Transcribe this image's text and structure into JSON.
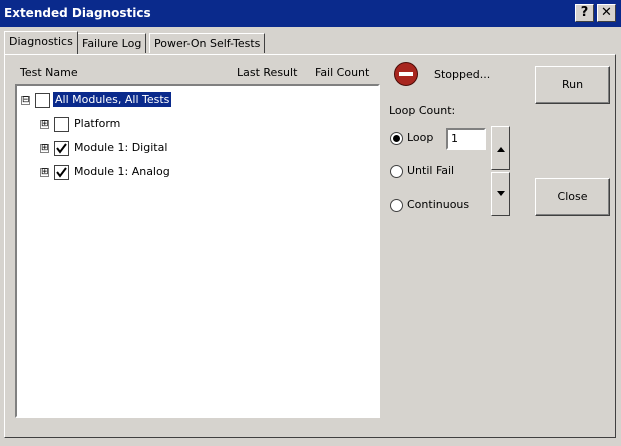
{
  "window": {
    "title": "Extended Diagnostics",
    "help_label": "?",
    "close_label": "✕"
  },
  "tabs": [
    {
      "label": "Diagnostics",
      "active": true
    },
    {
      "label": "Failure Log",
      "active": false
    },
    {
      "label": "Power-On Self-Tests",
      "active": false
    }
  ],
  "tree": {
    "headers": {
      "name": "Test Name",
      "last_result": "Last Result",
      "fail_count": "Fail Count"
    },
    "items": [
      {
        "label": "All Modules, All Tests",
        "checked": false,
        "expander": "⊟",
        "selected": true
      },
      {
        "label": "Platform",
        "checked": false,
        "expander": "⊞"
      },
      {
        "label": "Module 1: Digital",
        "checked": true,
        "expander": "⊞"
      },
      {
        "label": "Module 1: Analog",
        "checked": true,
        "expander": "⊞"
      }
    ]
  },
  "status": {
    "text": "Stopped...",
    "color": "#a8261f"
  },
  "buttons": {
    "run": "Run",
    "close": "Close"
  },
  "loop": {
    "title": "Loop Count:",
    "options": [
      {
        "label": "Loop",
        "selected": true
      },
      {
        "label": "Until Fail",
        "selected": false
      },
      {
        "label": "Continuous",
        "selected": false
      }
    ],
    "value": "1"
  },
  "colors": {
    "titlebar": "#0a2a8c",
    "face": "#d6d3ce",
    "selection": "#0a2a8c"
  }
}
